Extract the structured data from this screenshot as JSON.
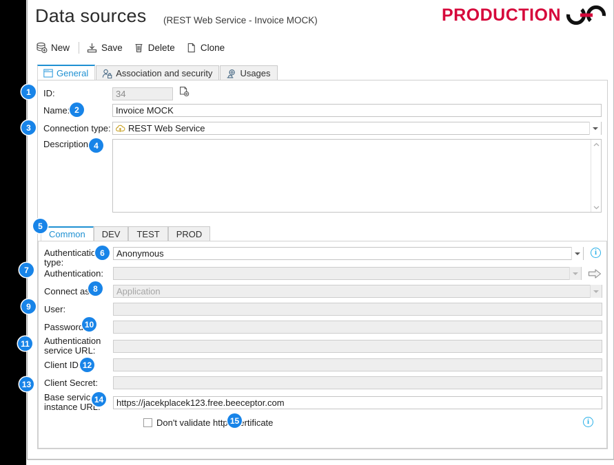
{
  "window": {
    "title": "Data sources",
    "subtitle": "(REST Web Service - Invoice MOCK)"
  },
  "brand": {
    "text": "PRODUCTION",
    "mark_icon": "chain-link-icon",
    "color": "#d6083b"
  },
  "toolbar": {
    "items": [
      {
        "label": "New",
        "icon": "database-add-icon"
      },
      {
        "label": "Save",
        "icon": "save-icon"
      },
      {
        "label": "Delete",
        "icon": "trash-icon"
      },
      {
        "label": "Clone",
        "icon": "copy-document-icon"
      }
    ]
  },
  "tabs": [
    {
      "label": "General",
      "icon": "window-icon",
      "active": true
    },
    {
      "label": "Association and security",
      "icon": "user-lock-icon",
      "active": false
    },
    {
      "label": "Usages",
      "icon": "gear-stamp-icon",
      "active": false
    }
  ],
  "general": {
    "id": {
      "label": "ID:",
      "value": "34",
      "disabled": true,
      "side_icon": "document-gear-icon"
    },
    "name": {
      "label": "Name:",
      "value": "Invoice MOCK",
      "disabled": false
    },
    "connection_type": {
      "label": "Connection type:",
      "value": "REST Web Service",
      "icon": "cloud-upload-icon",
      "disabled": false
    },
    "description": {
      "label": "Description:",
      "value": "",
      "placeholder": ""
    }
  },
  "env_tabs": [
    {
      "label": "Common",
      "active": true
    },
    {
      "label": "DEV",
      "active": false
    },
    {
      "label": "TEST",
      "active": false
    },
    {
      "label": "PROD",
      "active": false
    }
  ],
  "common": {
    "auth_type": {
      "label": "Authentication type:",
      "value": "Anonymous",
      "disabled": false,
      "info_icon": "info-icon"
    },
    "authentication": {
      "label": "Authentication:",
      "value": "",
      "disabled": true,
      "side_icon": "arrow-right-icon"
    },
    "connect_as": {
      "label": "Connect as:",
      "value": "Application",
      "disabled": true,
      "ghost": true
    },
    "user": {
      "label": "User:",
      "value": "",
      "disabled": true
    },
    "password": {
      "label": "Password:",
      "value": "",
      "disabled": true
    },
    "auth_service_url": {
      "label": "Authentication service URL:",
      "value": "",
      "disabled": true
    },
    "client_id": {
      "label": "Client ID:",
      "value": "",
      "disabled": true
    },
    "client_secret": {
      "label": "Client Secret:",
      "value": "",
      "disabled": true
    },
    "base_service_url": {
      "label": "Base service instance URL:",
      "value": "https://jacekplacek123.free.beeceptor.com",
      "disabled": false
    },
    "no_validate_https": {
      "label": "Don't validate https certificate",
      "checked": false,
      "info_icon": "info-icon"
    }
  },
  "badges": [
    {
      "n": "1"
    },
    {
      "n": "2"
    },
    {
      "n": "3"
    },
    {
      "n": "4"
    },
    {
      "n": "5"
    },
    {
      "n": "6"
    },
    {
      "n": "7"
    },
    {
      "n": "8"
    },
    {
      "n": "9"
    },
    {
      "n": "10"
    },
    {
      "n": "11"
    },
    {
      "n": "12"
    },
    {
      "n": "13"
    },
    {
      "n": "14"
    },
    {
      "n": "15"
    }
  ],
  "accent_color": "#1e90d2",
  "badge_color": "#1884e8"
}
